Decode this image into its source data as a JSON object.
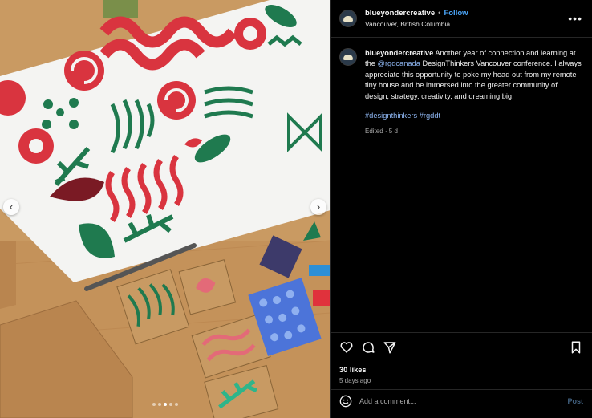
{
  "post": {
    "username": "blueyondercreative",
    "follow_label": "Follow",
    "separator": "•",
    "location": "Vancouver, British Columbia",
    "more_label": "•••",
    "caption_user": "blueyondercreative",
    "caption_part1": " Another year of connection and learning at the ",
    "caption_mention": "@rgdcanada",
    "caption_part2": " DesignThinkers Vancouver conference. I always appreciate this opportunity to poke my head out from my remote tiny house and be immersed into the greater community of design, strategy, creativity, and dreaming big.",
    "hashtag1": "#designthinkers",
    "hashtag2": "#rgddt",
    "edited": "Edited · 5 d",
    "likes": "30 likes",
    "posted_ago": "5 days ago",
    "comment_placeholder": "Add a comment...",
    "post_label": "Post"
  },
  "carousel": {
    "prev_label": "‹",
    "next_label": "›",
    "slide_count": 5,
    "active_slide": 3
  },
  "colors": {
    "accent_blue": "#4aa3f5",
    "link": "#8fb7f3",
    "post_disabled": "#41607f",
    "print_red": "#d9343f",
    "print_green": "#1f7a4f"
  },
  "icons": {
    "like": "heart-icon",
    "comment": "comment-icon",
    "share": "share-icon",
    "save": "bookmark-icon",
    "emoji": "emoji-icon",
    "more": "more-options-icon"
  }
}
